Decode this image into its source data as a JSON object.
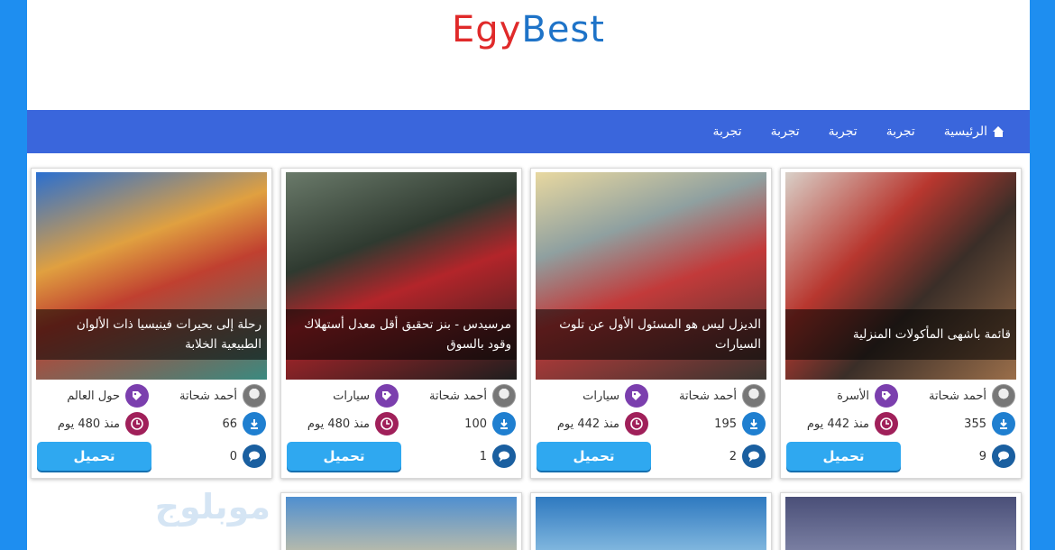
{
  "logo": {
    "part1": "Egy",
    "part2": "Best"
  },
  "nav": {
    "home_label": "الرئيسية",
    "items": [
      "تجربة",
      "تجربة",
      "تجربة",
      "تجربة"
    ]
  },
  "cards": [
    {
      "title": "قائمة باشهى المأكولات المنزلية",
      "author": "أحمد شحاتة",
      "category": "الأسرة",
      "downloads": "355",
      "age": "منذ 442 يوم",
      "comments": "9",
      "button": "تحميل"
    },
    {
      "title": "الديزل ليس هو المسئول الأول عن تلوث السيارات",
      "author": "أحمد شحاتة",
      "category": "سيارات",
      "downloads": "195",
      "age": "منذ 442 يوم",
      "comments": "2",
      "button": "تحميل"
    },
    {
      "title": "مرسيدس - بنز تحقيق أقل معدل أستهلاك وقود بالسوق",
      "author": "أحمد شحاتة",
      "category": "سيارات",
      "downloads": "100",
      "age": "منذ 480 يوم",
      "comments": "1",
      "button": "تحميل"
    },
    {
      "title": "رحلة إلى بحيرات فينيسيا ذات الألوان الطبيعية الخلابة",
      "author": "أحمد شحاتة",
      "category": "حول العالم",
      "downloads": "66",
      "age": "منذ 480 يوم",
      "comments": "0",
      "button": "تحميل"
    }
  ],
  "watermark": "موبلوج",
  "colors": {
    "nav": "#3a66dc",
    "side": "#1e8ef0",
    "button": "#2fa8f0"
  }
}
